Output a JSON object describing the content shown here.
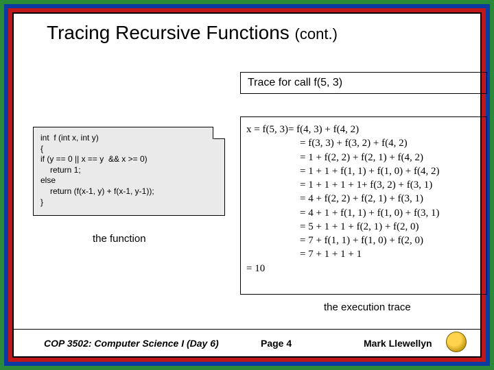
{
  "title": {
    "main": "Tracing Recursive Functions",
    "cont": "(cont.)"
  },
  "trace_header": "Trace for call f(5, 3)",
  "code": {
    "l1": "int  f (int x, int y)",
    "l2": "{",
    "l3": "if (y == 0 || x == y  && x >= 0)",
    "l4": "return 1;",
    "l5": "else",
    "l6": "return (f(x-1, y) + f(x-1, y-1));",
    "l7": "}"
  },
  "function_label": "the function",
  "trace": {
    "first": "x = f(5, 3)= f(4, 3) + f(4, 2)",
    "l2": "= f(3, 3) + f(3, 2) + f(4, 2)",
    "l3": "= 1 + f(2, 2) + f(2, 1) + f(4, 2)",
    "l4": "= 1 + 1 + f(1, 1) + f(1, 0) + f(4, 2)",
    "l5": "= 1 + 1 + 1 + 1+ f(3, 2) + f(3, 1)",
    "l6": "= 4 + f(2, 2) + f(2, 1) + f(3, 1)",
    "l7": "= 4 + 1 + f(1, 1) + f(1, 0) + f(3, 1)",
    "l8": "= 5 + 1 + 1 + f(2, 1) + f(2, 0)",
    "l9": "= 7 + f(1, 1) + f(1, 0) + f(2, 0)",
    "l10": "= 7 + 1 + 1 + 1",
    "last": "= 10"
  },
  "execution_label": "the execution trace",
  "footer": {
    "left": "COP 3502: Computer Science I  (Day 6)",
    "center": "Page 4",
    "right": "Mark Llewellyn"
  }
}
